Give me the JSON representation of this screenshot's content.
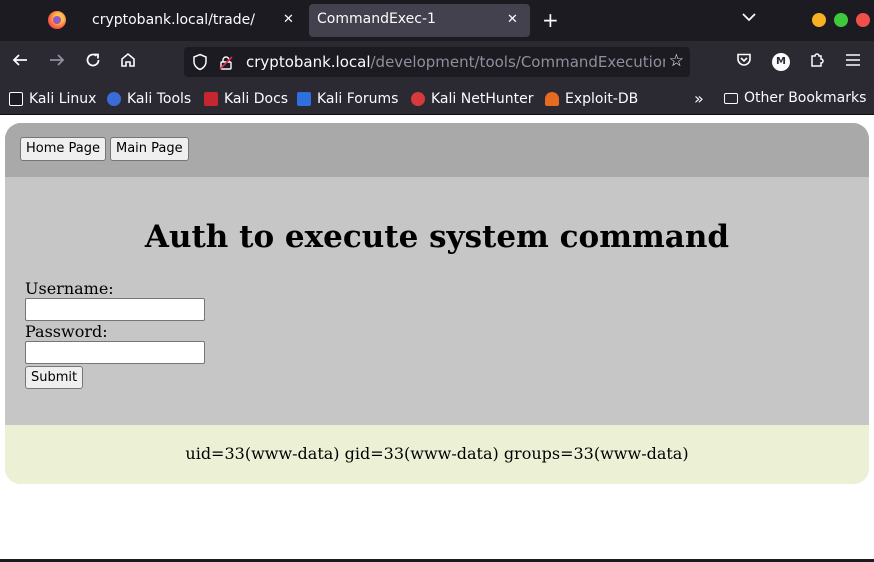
{
  "browser": {
    "tabs": [
      {
        "title": "cryptobank.local/trade/",
        "active": false
      },
      {
        "title": "CommandExec-1",
        "active": true
      }
    ],
    "url": {
      "host": "cryptobank.local",
      "path": "/development/tools/CommandExecution"
    },
    "profile_initial": "M",
    "bookmarks": [
      {
        "label": "Kali Linux",
        "icon": "kali-dragon-icon"
      },
      {
        "label": "Kali Tools",
        "icon": "kali-tools-icon"
      },
      {
        "label": "Kali Docs",
        "icon": "kali-docs-icon"
      },
      {
        "label": "Kali Forums",
        "icon": "kali-forums-icon"
      },
      {
        "label": "Kali NetHunter",
        "icon": "kali-nethunter-icon"
      },
      {
        "label": "Exploit-DB",
        "icon": "exploit-db-icon"
      }
    ],
    "other_bookmarks": "Other Bookmarks"
  },
  "page": {
    "nav": {
      "home_label": "Home Page",
      "main_label": "Main Page"
    },
    "heading": "Auth to execute system command",
    "form": {
      "username_label": "Username:",
      "username_value": "",
      "password_label": "Password:",
      "password_value": "",
      "submit_label": "Submit"
    },
    "output": "uid=33(www-data) gid=33(www-data) groups=33(www-data)"
  },
  "colors": {
    "nav_band": "#a9a9a9",
    "card_bg": "#c6c6c6",
    "output_bg": "#ecf1d6",
    "chrome_dark": "#1c1b22",
    "chrome_toolbar": "#2b2a33"
  }
}
